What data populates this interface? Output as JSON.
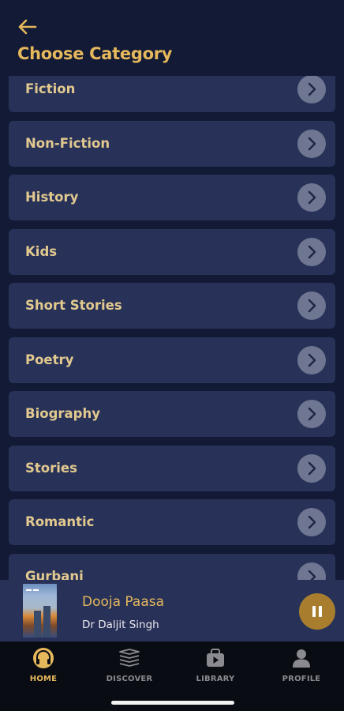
{
  "header": {
    "back_icon": "arrow-left-icon",
    "title": "Choose Category"
  },
  "categories": [
    {
      "label": "Fiction"
    },
    {
      "label": "Non-Fiction"
    },
    {
      "label": "History"
    },
    {
      "label": "Kids"
    },
    {
      "label": "Short Stories"
    },
    {
      "label": "Poetry"
    },
    {
      "label": "Biography"
    },
    {
      "label": "Stories"
    },
    {
      "label": "Romantic"
    },
    {
      "label": "Gurbani"
    }
  ],
  "player": {
    "title": "Dooja Paasa",
    "artist": "Dr Daljit Singh",
    "pause_icon": "pause-icon"
  },
  "tabs": [
    {
      "label": "HOME",
      "icon": "headphones-icon",
      "active": true
    },
    {
      "label": "DISCOVER",
      "icon": "book-stack-icon",
      "active": false
    },
    {
      "label": "LIBRARY",
      "icon": "play-library-icon",
      "active": false
    },
    {
      "label": "PROFILE",
      "icon": "user-icon",
      "active": false
    }
  ],
  "colors": {
    "background": "#131a36",
    "card": "#283258",
    "accent": "#e6b85c",
    "tab_bar": "#0a0c14"
  }
}
